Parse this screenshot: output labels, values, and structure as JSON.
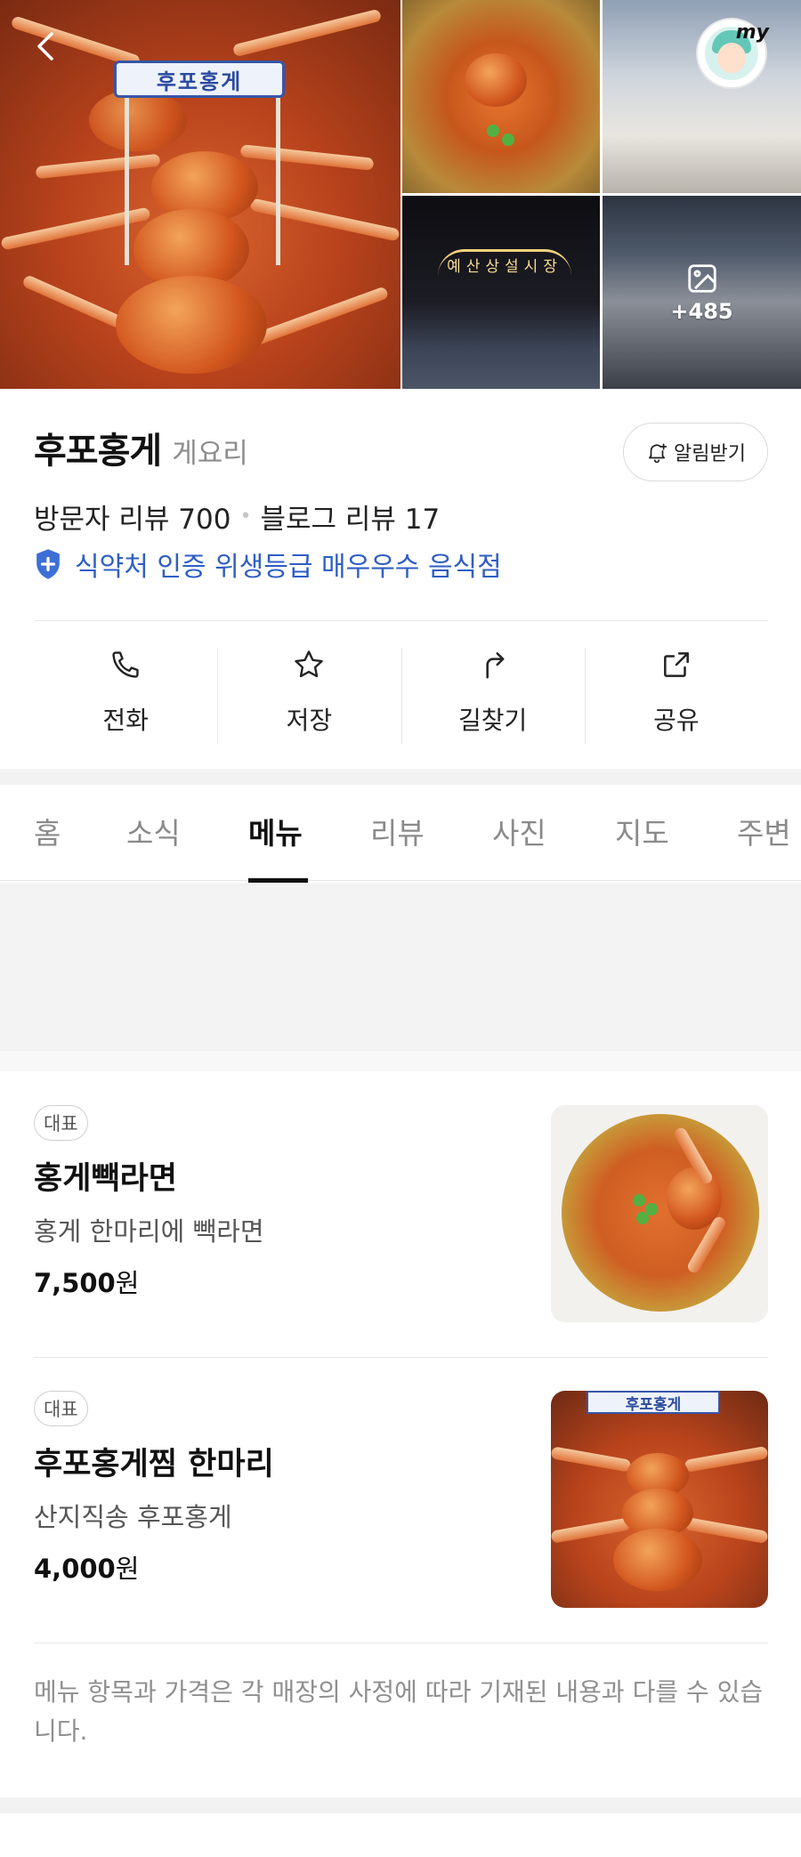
{
  "gallery": {
    "sign_text": "후포홍게",
    "more_count": "+485",
    "profile_tag": "my",
    "neon_text": "예산상설시장"
  },
  "store": {
    "name": "후포홍게",
    "category": "게요리",
    "alarm_label": "알림받기",
    "visitor_reviews": "방문자 리뷰 700",
    "blog_reviews": "블로그 리뷰 17",
    "certification": "식약처 인증 위생등급 매우우수 음식점"
  },
  "actions": [
    {
      "label": "전화",
      "icon": "phone-icon"
    },
    {
      "label": "저장",
      "icon": "star-icon"
    },
    {
      "label": "길찾기",
      "icon": "directions-icon"
    },
    {
      "label": "공유",
      "icon": "share-icon"
    }
  ],
  "tabs": [
    {
      "label": "홈",
      "active": false
    },
    {
      "label": "소식",
      "active": false
    },
    {
      "label": "메뉴",
      "active": true
    },
    {
      "label": "리뷰",
      "active": false
    },
    {
      "label": "사진",
      "active": false
    },
    {
      "label": "지도",
      "active": false
    },
    {
      "label": "주변",
      "active": false
    }
  ],
  "menu": [
    {
      "badge": "대표",
      "name": "홍게빽라면",
      "desc": "홍게 한마리에 빽라면",
      "price": "7,500",
      "unit": "원"
    },
    {
      "badge": "대표",
      "name": "후포홍게찜 한마리",
      "desc": "산지직송 후포홍게",
      "price": "4,000",
      "unit": "원"
    }
  ],
  "notice": "메뉴 항목과 가격은 각 매장의 사정에 따라 기재된 내용과 다를 수 있습니다.",
  "colors": {
    "accent_blue": "#2f5ec4",
    "text_main": "#111111",
    "text_muted": "#8a8a8a"
  }
}
